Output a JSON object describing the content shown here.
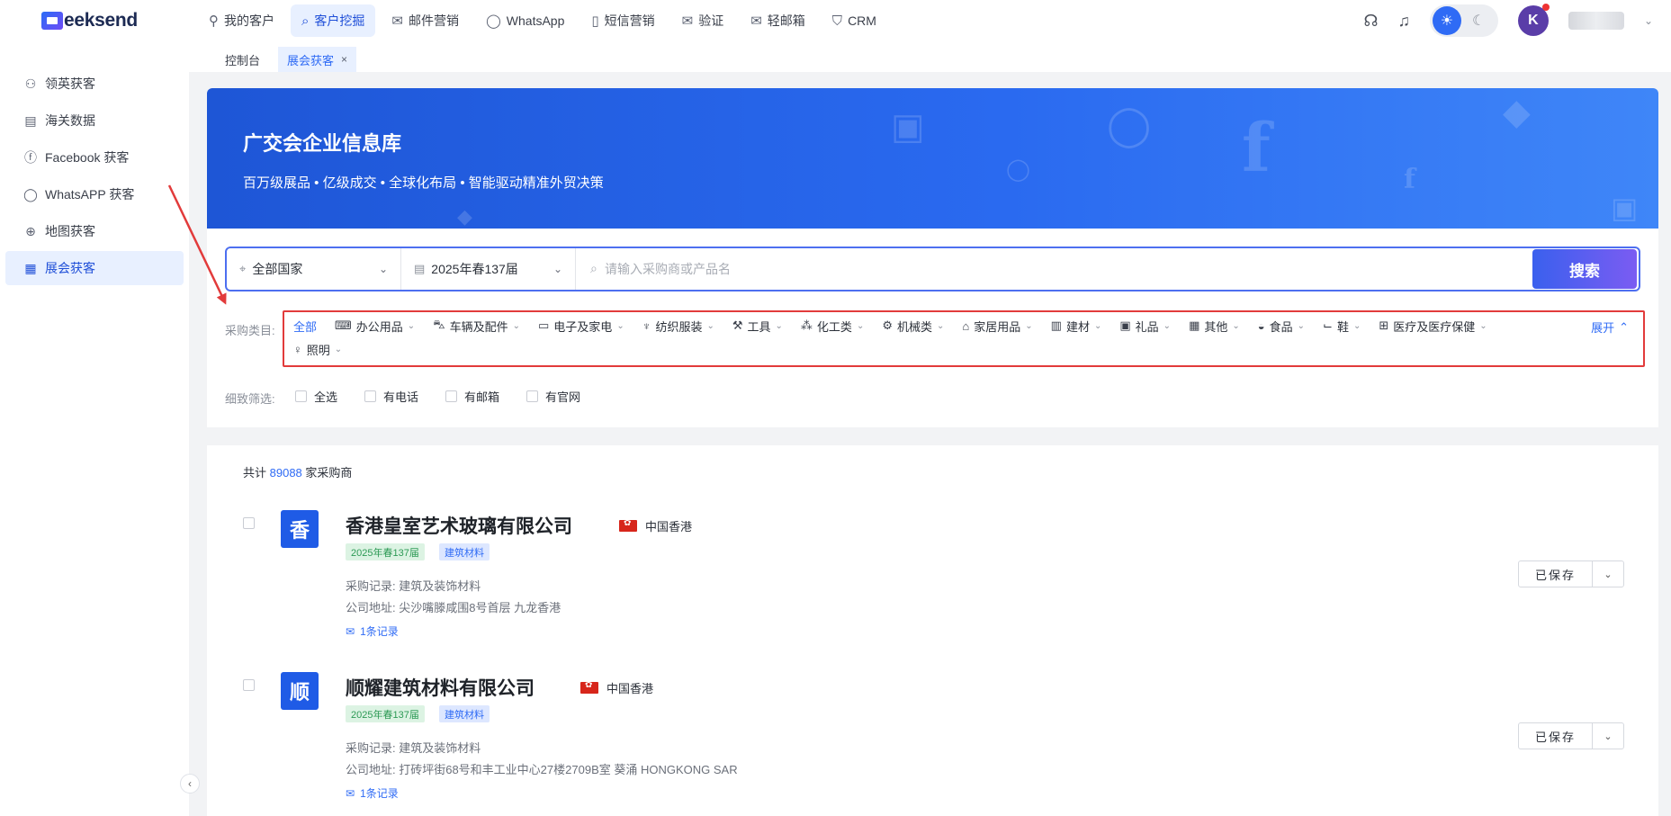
{
  "app": {
    "logo_text": "eeksend"
  },
  "nav": [
    {
      "label": "我的客户",
      "icon": "user-icon"
    },
    {
      "label": "客户挖掘",
      "icon": "search-icon",
      "active": true
    },
    {
      "label": "邮件营销",
      "icon": "mail-icon"
    },
    {
      "label": "WhatsApp",
      "icon": "whatsapp-icon"
    },
    {
      "label": "短信营销",
      "icon": "sms-icon"
    },
    {
      "label": "验证",
      "icon": "verify-mail-icon"
    },
    {
      "label": "轻邮箱",
      "icon": "mailbox-icon"
    },
    {
      "label": "CRM",
      "icon": "crm-shield-icon"
    }
  ],
  "header": {
    "avatar_letter": "K"
  },
  "tabs": [
    {
      "label": "控制台"
    },
    {
      "label": "展会获客",
      "active": true,
      "close": "×"
    }
  ],
  "sidebar": {
    "items": [
      {
        "label": "领英获客",
        "icon": "person-search-icon"
      },
      {
        "label": "海关数据",
        "icon": "document-icon"
      },
      {
        "label": "Facebook 获客",
        "icon": "facebook-icon"
      },
      {
        "label": "WhatsAPP 获客",
        "icon": "whatsapp-icon"
      },
      {
        "label": "地图获客",
        "icon": "globe-icon"
      },
      {
        "label": "展会获客",
        "icon": "calendar-icon",
        "active": true
      }
    ]
  },
  "hero": {
    "title": "广交会企业信息库",
    "subtitle": "百万级展品 • 亿级成交 • 全球化布局 • 智能驱动精准外贸决策"
  },
  "search": {
    "country": "全部国家",
    "session": "2025年春137届",
    "placeholder": "请输入采购商或产品名",
    "button": "搜索"
  },
  "categories": {
    "label": "采购类目:",
    "expand": "展开",
    "items": [
      {
        "label": "全部",
        "active": true
      },
      {
        "label": "办公用品",
        "icon": "office-icon"
      },
      {
        "label": "车辆及配件",
        "icon": "car-icon"
      },
      {
        "label": "电子及家电",
        "icon": "tv-icon"
      },
      {
        "label": "纺织服装",
        "icon": "shirt-icon"
      },
      {
        "label": "工具",
        "icon": "tool-icon"
      },
      {
        "label": "化工类",
        "icon": "molecule-icon"
      },
      {
        "label": "机械类",
        "icon": "machine-icon"
      },
      {
        "label": "家居用品",
        "icon": "sofa-icon"
      },
      {
        "label": "建材",
        "icon": "brick-icon"
      },
      {
        "label": "礼品",
        "icon": "gift-icon"
      },
      {
        "label": "其他",
        "icon": "grid-icon"
      },
      {
        "label": "食品",
        "icon": "bowl-icon"
      },
      {
        "label": "鞋",
        "icon": "shoe-icon"
      },
      {
        "label": "医疗及医疗保健",
        "icon": "medical-kit-icon"
      },
      {
        "label": "照明",
        "icon": "bulb-icon"
      }
    ]
  },
  "filters": {
    "label": "细致筛选:",
    "options": [
      "全选",
      "有电话",
      "有邮箱",
      "有官网"
    ]
  },
  "results": {
    "prefix": "共计",
    "count": "89088",
    "suffix": "家采购商",
    "companies": [
      {
        "avatar": "香",
        "name": "香港皇室艺术玻璃有限公司",
        "location": "中国香港",
        "tags": [
          "2025年春137届",
          "建筑材料"
        ],
        "purchase": "采购记录: 建筑及装饰材料",
        "address": "公司地址: 尖沙嘴滕咸围8号首层 九龙香港",
        "records": "1条记录",
        "saved": "已保存"
      },
      {
        "avatar": "顺",
        "name": "顺耀建筑材料有限公司",
        "location": "中国香港",
        "tags": [
          "2025年春137届",
          "建筑材料"
        ],
        "purchase": "采购记录: 建筑及装饰材料",
        "address": "公司地址: 打砖坪街68号和丰工业中心27楼2709B室 葵涌 HONGKONG SAR",
        "records": "1条记录",
        "saved": "已保存"
      }
    ]
  },
  "colors": {
    "primary": "#2f6bf5",
    "highlight_box": "#e23b3b",
    "hero_start": "#1e56d6"
  }
}
